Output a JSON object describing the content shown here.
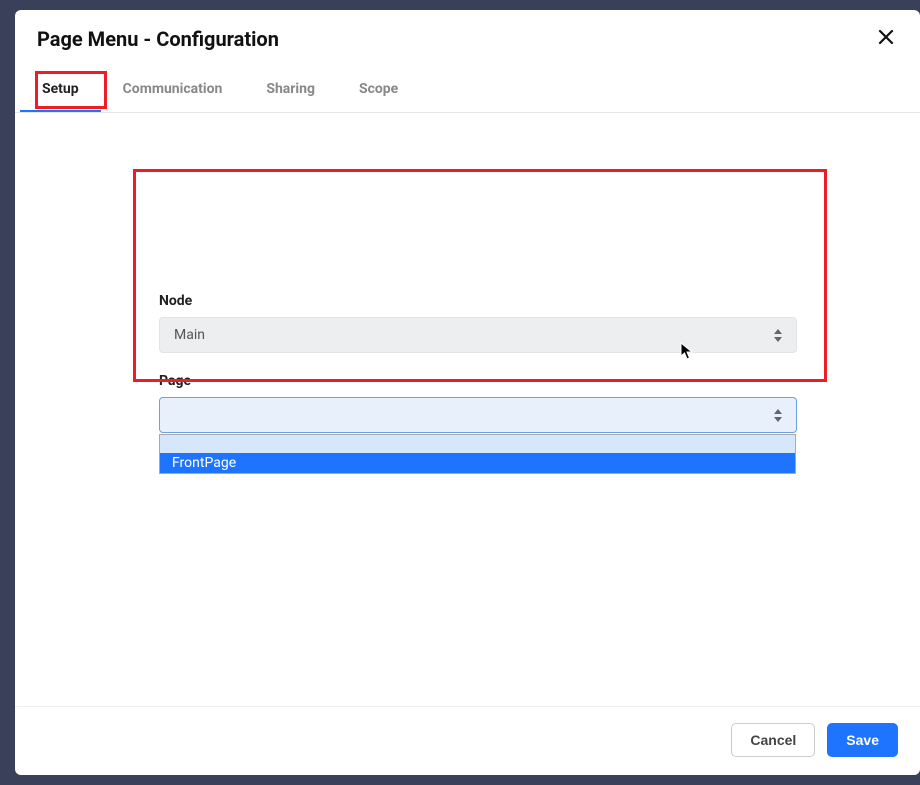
{
  "header": {
    "title": "Page Menu - Configuration"
  },
  "tabs": {
    "setup": "Setup",
    "communication": "Communication",
    "sharing": "Sharing",
    "scope": "Scope"
  },
  "form": {
    "node_label": "Node",
    "node_value": "Main",
    "page_label": "Page",
    "page_value": "",
    "page_options": {
      "blank": "",
      "frontpage": "FrontPage"
    }
  },
  "footer": {
    "cancel": "Cancel",
    "save": "Save"
  }
}
